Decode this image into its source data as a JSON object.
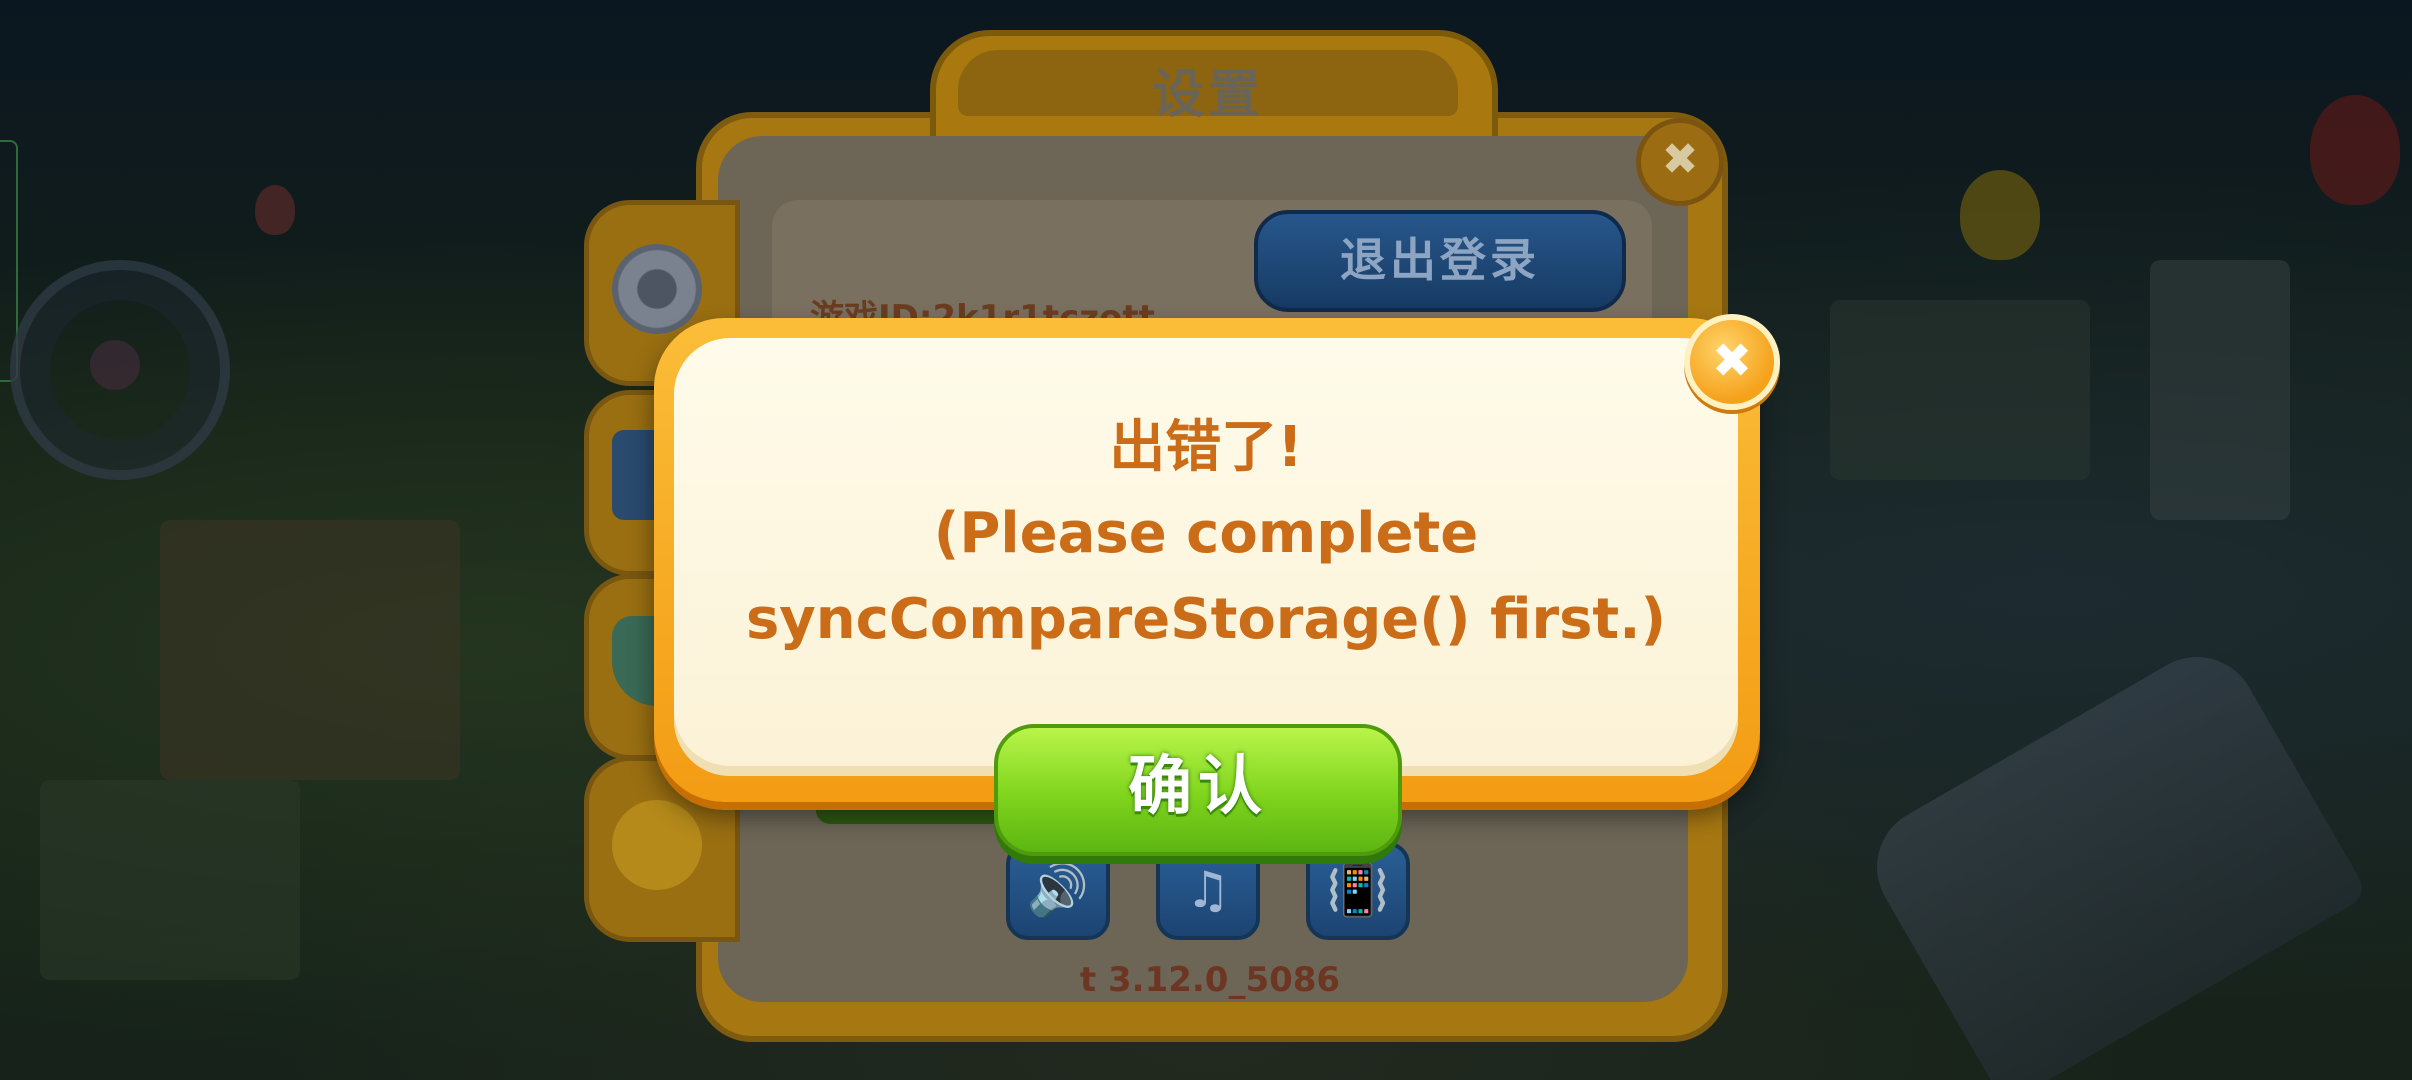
{
  "settings": {
    "title": "设置",
    "logout_label": "退出登录",
    "game_id_text": "游戏ID:2k1r1tczott",
    "version_text": "t 3.12.0_5086",
    "close_symbol": "✖",
    "icons": {
      "gear": "gear-icon",
      "book": "book-icon",
      "shield": "shield-icon",
      "smile": "smiley-icon",
      "sound": "speaker-icon",
      "music": "music-note-icon",
      "vibrate": "vibrate-phone-icon"
    },
    "sound_symbol": "🔊",
    "music_symbol": "♫",
    "vibrate_symbol": "📳"
  },
  "error_dialog": {
    "title": "出错了!",
    "message_line1": "(Please complete",
    "message_line2": "syncCompareStorage() first.)",
    "confirm_label": "确认",
    "close_symbol": "✖"
  },
  "colors": {
    "dialog_text": "#cb6d18",
    "dialog_frame": "#f39c14",
    "confirm_green": "#7fd41c",
    "logout_blue": "#27578c"
  }
}
